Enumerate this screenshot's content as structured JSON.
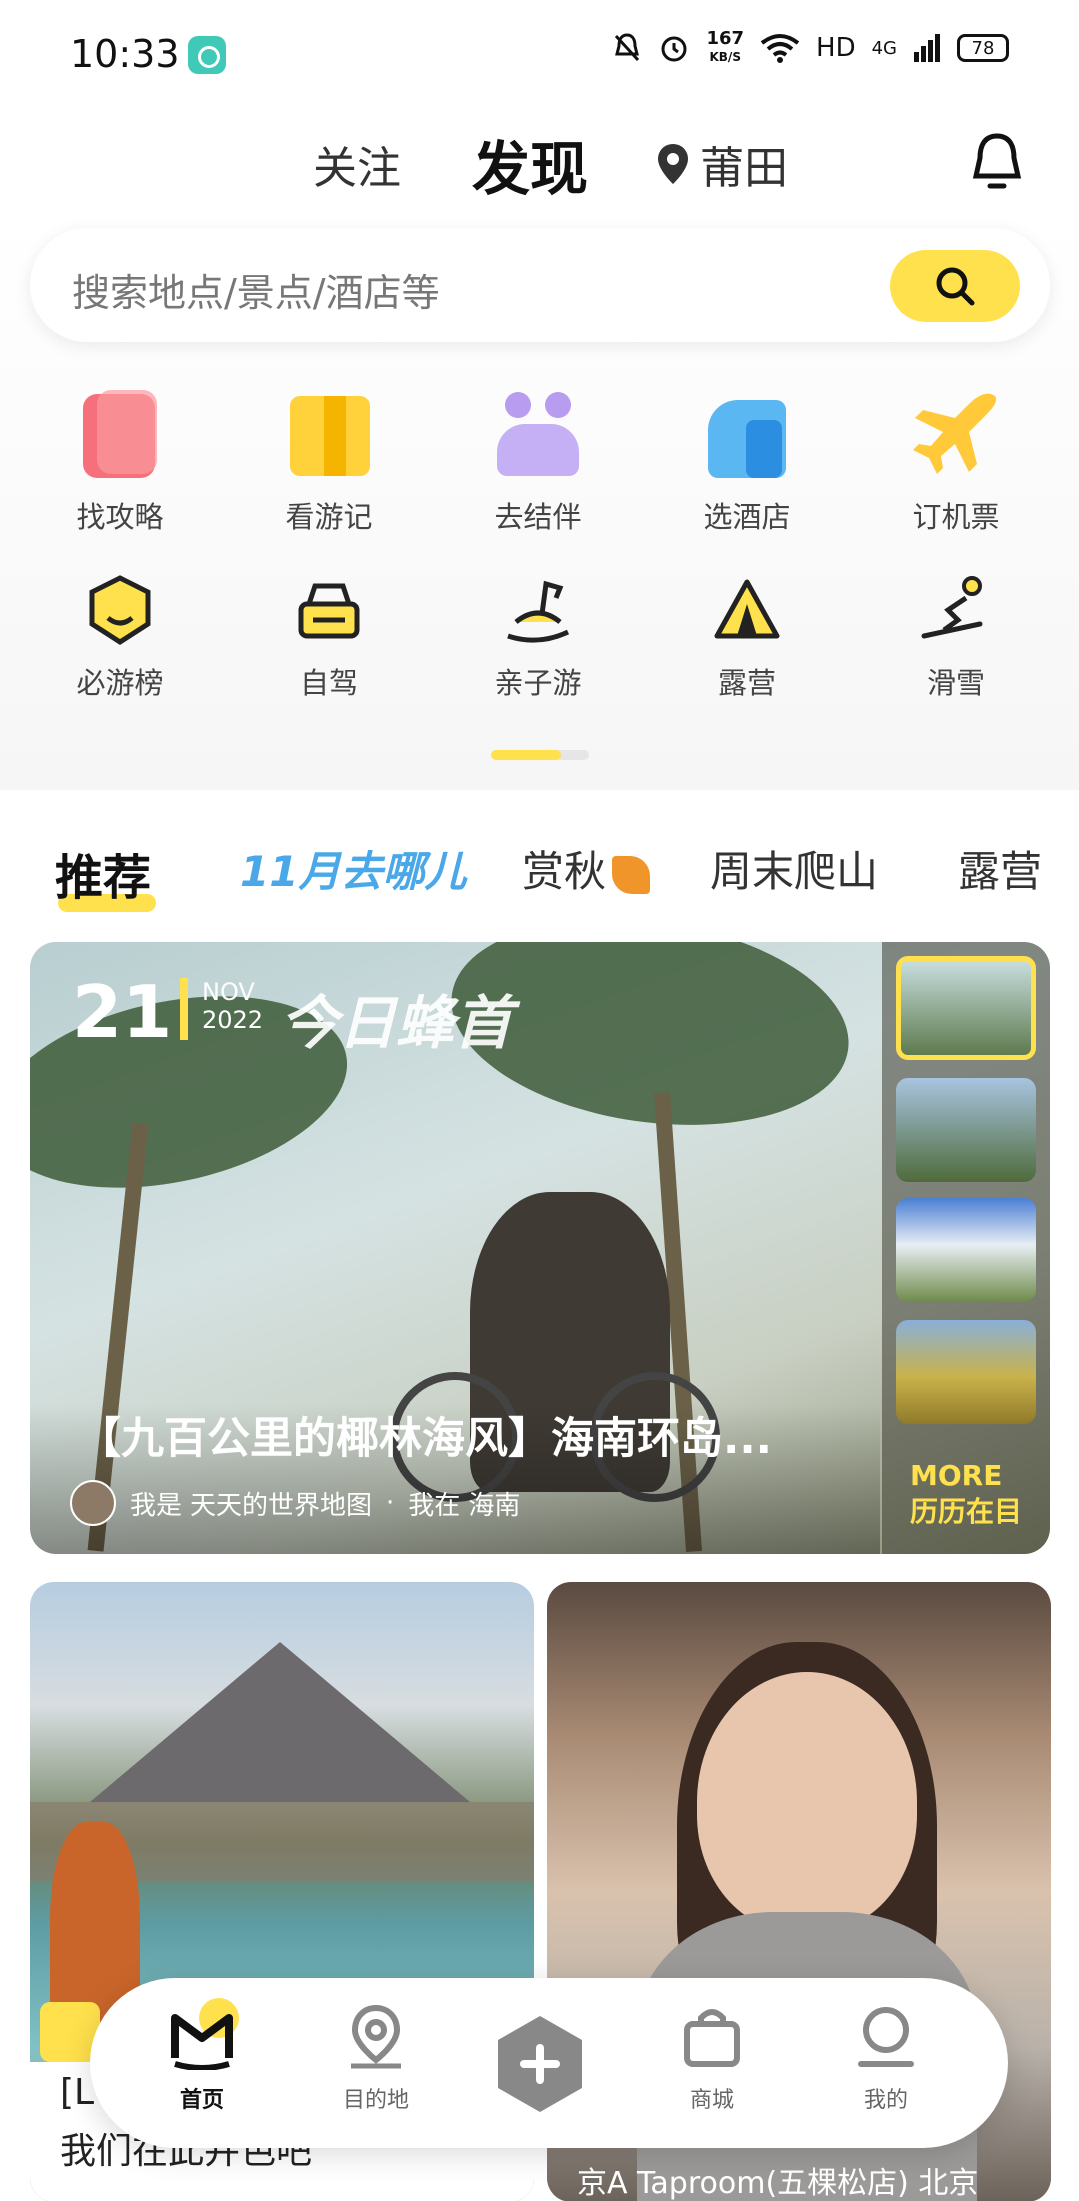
{
  "status_bar": {
    "time": "10:33",
    "speed_value": "167",
    "speed_unit": "KB/S",
    "hd": "HD",
    "network": "4G",
    "battery": "78"
  },
  "header": {
    "follow_tab": "关注",
    "discover_tab": "发现",
    "location": "莆田"
  },
  "search": {
    "placeholder": "搜索地点/景点/酒店等"
  },
  "quick_actions": [
    {
      "label": "找攻略",
      "icon": "guide-icon",
      "color": "#f5707a"
    },
    {
      "label": "看游记",
      "icon": "travelogue-icon",
      "color": "#ffd23b"
    },
    {
      "label": "去结伴",
      "icon": "companion-icon",
      "color": "#b79cf0"
    },
    {
      "label": "选酒店",
      "icon": "hotel-icon",
      "color": "#5bb7f2"
    },
    {
      "label": "订机票",
      "icon": "plane-icon",
      "color": "#ffc93a"
    }
  ],
  "category_actions": [
    {
      "label": "必游榜",
      "icon": "ranking-icon"
    },
    {
      "label": "自驾",
      "icon": "car-icon"
    },
    {
      "label": "亲子游",
      "icon": "rocking-horse-icon"
    },
    {
      "label": "露营",
      "icon": "tent-icon"
    },
    {
      "label": "滑雪",
      "icon": "ski-icon"
    }
  ],
  "feed_tabs": {
    "recommend": "推荐",
    "promo": "11月去哪儿",
    "autumn": "赏秋",
    "hiking": "周末爬山",
    "camping": "露营"
  },
  "hero": {
    "day": "21",
    "month": "NOV",
    "year": "2022",
    "brand": "今日蜂首",
    "title": "【九百公里的椰林海风】海南环岛...",
    "author_prefix": "我是",
    "author": "天天的世界地图",
    "location_prefix": "我在",
    "location": "海南",
    "more_label": "MORE",
    "more_sub": "历历在目"
  },
  "cards": [
    {
      "title_line1": "[L",
      "title_line2": "我们在此并色吧"
    },
    {
      "location": "京A Taproom(五棵松店) 北京"
    }
  ],
  "tabbar": {
    "home": "首页",
    "destination": "目的地",
    "mall": "商城",
    "mine": "我的"
  },
  "colors": {
    "accent": "#ffe14d",
    "text_primary": "#111111",
    "text_secondary": "#444444"
  }
}
